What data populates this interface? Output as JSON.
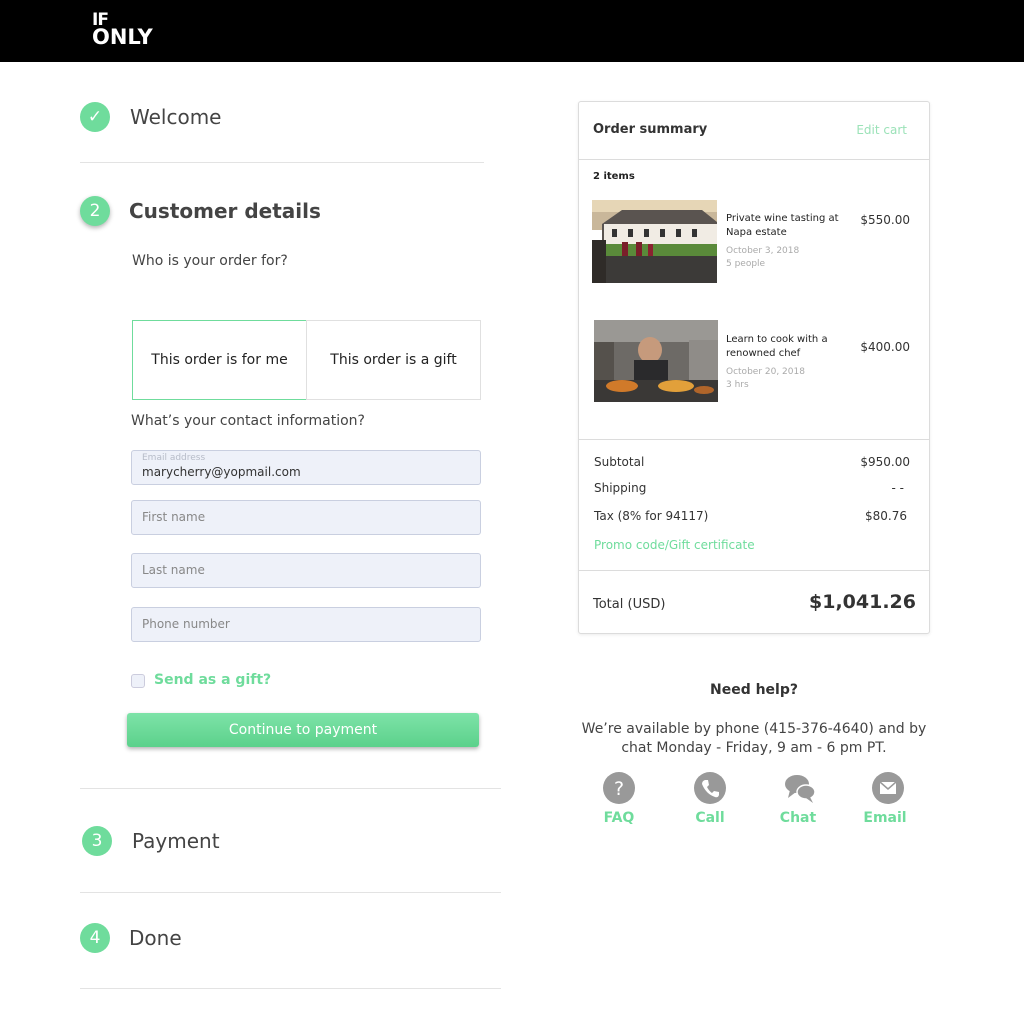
{
  "brand": {
    "logo_line1": "IF",
    "logo_line2": "ONLY"
  },
  "steps": [
    {
      "number": "✓",
      "title": "Welcome"
    },
    {
      "number": "2",
      "title": "Customer details"
    },
    {
      "number": "3",
      "title": "Payment"
    },
    {
      "number": "4",
      "title": "Done"
    }
  ],
  "customer": {
    "who_question": "Who is your order for?",
    "option_me": "This order is for me",
    "option_gift": "This order is a gift",
    "contact_question": "What’s your contact information?",
    "email_label": "Email address",
    "email_value": "marycherry@yopmail.com",
    "first_name_placeholder": "First name",
    "last_name_placeholder": "Last name",
    "phone_placeholder": "Phone number",
    "send_gift_label": "Send as a gift?",
    "continue_label": "Continue to payment"
  },
  "summary": {
    "title": "Order summary",
    "edit_cart": "Edit cart",
    "items_count": "2 items",
    "items": [
      {
        "title": "Private wine tasting at Napa estate",
        "date": "October 3, 2018",
        "detail": "5 people",
        "price": "$550.00"
      },
      {
        "title": "Learn to cook with a renowned chef",
        "date": "October 20, 2018",
        "detail": "3 hrs",
        "price": "$400.00"
      }
    ],
    "subtotal_label": "Subtotal",
    "subtotal_value": "$950.00",
    "shipping_label": "Shipping",
    "shipping_value": "- -",
    "tax_label": "Tax (8% for 94117)",
    "tax_value": "$80.76",
    "promo_label": "Promo code/Gift certificate",
    "total_label": "Total (USD)",
    "total_value": "$1,041.26"
  },
  "help": {
    "title": "Need help?",
    "text": "We’re available by phone (415-376-4640) and by chat Monday - Friday, 9 am - 6 pm PT.",
    "links": [
      {
        "label": "FAQ",
        "icon": "question-icon"
      },
      {
        "label": "Call",
        "icon": "phone-icon"
      },
      {
        "label": "Chat",
        "icon": "chat-icon"
      },
      {
        "label": "Email",
        "icon": "envelope-icon"
      }
    ]
  },
  "colors": {
    "accent": "#6fdc9c",
    "header_bg": "#000000",
    "field_bg": "#eef1f9"
  }
}
